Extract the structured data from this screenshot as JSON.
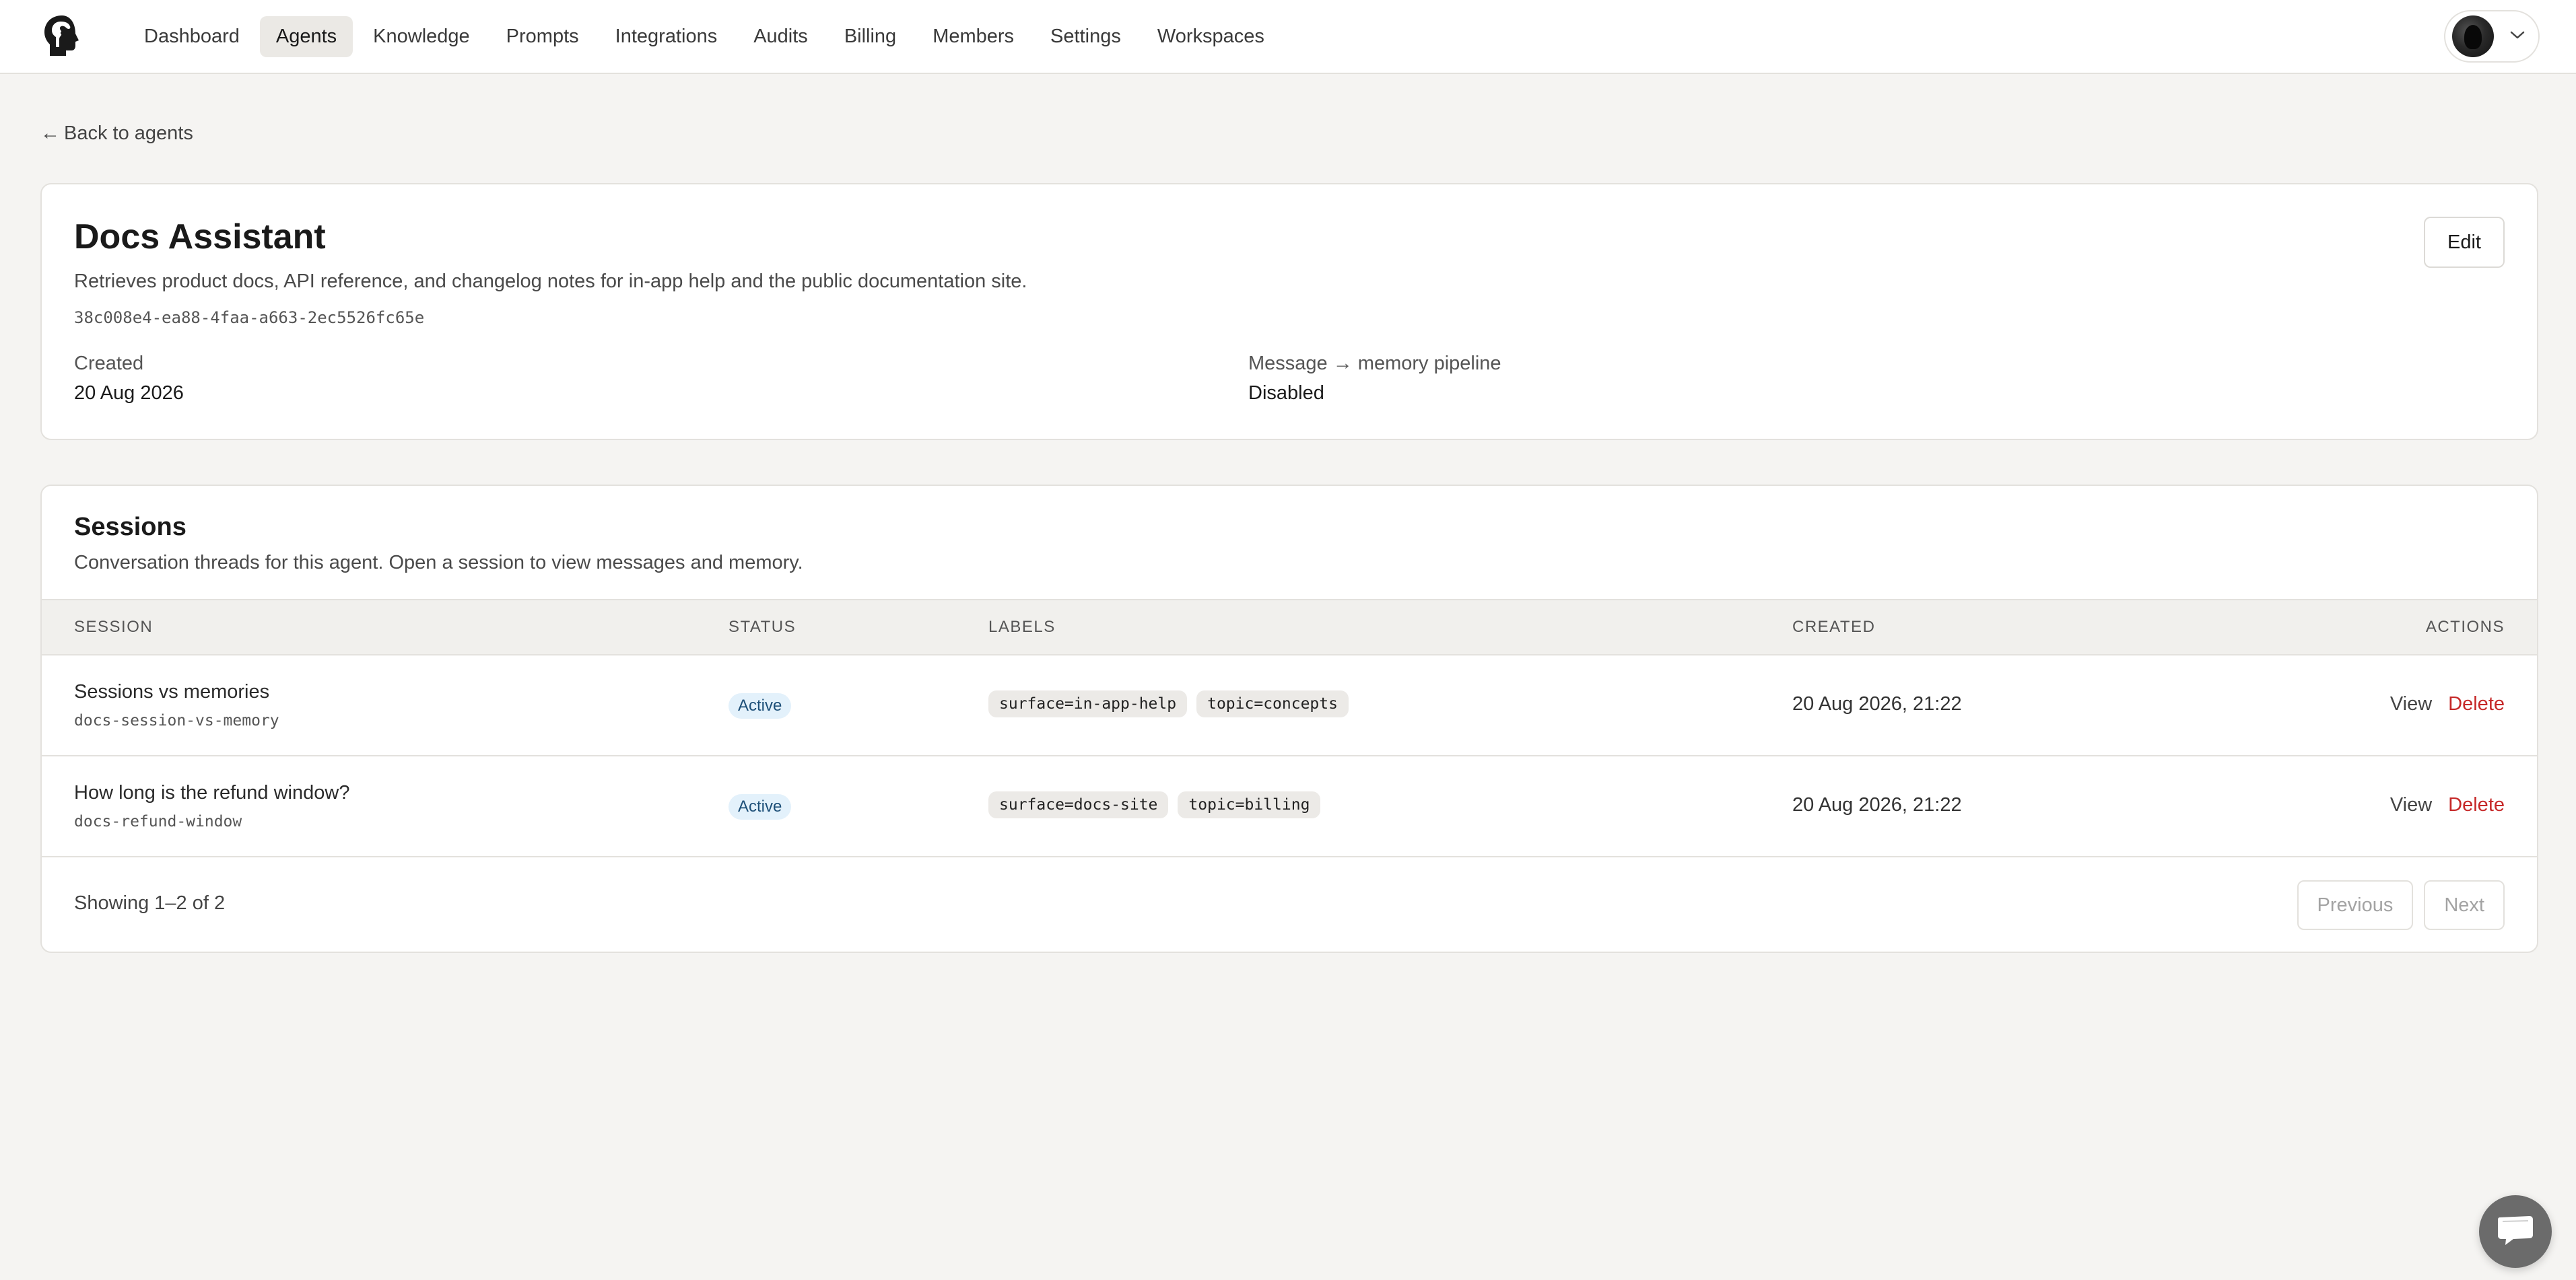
{
  "nav": {
    "items": [
      {
        "label": "Dashboard",
        "active": false
      },
      {
        "label": "Agents",
        "active": true
      },
      {
        "label": "Knowledge",
        "active": false
      },
      {
        "label": "Prompts",
        "active": false
      },
      {
        "label": "Integrations",
        "active": false
      },
      {
        "label": "Audits",
        "active": false
      },
      {
        "label": "Billing",
        "active": false
      },
      {
        "label": "Members",
        "active": false
      },
      {
        "label": "Settings",
        "active": false
      },
      {
        "label": "Workspaces",
        "active": false
      }
    ]
  },
  "back_link": {
    "arrow": "←",
    "label": "Back to agents"
  },
  "agent": {
    "name": "Docs Assistant",
    "description": "Retrieves product docs, API reference, and changelog notes for in-app help and the public documentation site.",
    "id": "38c008e4-ea88-4faa-a663-2ec5526fc65e",
    "edit_label": "Edit",
    "created_label": "Created",
    "created_value": "20 Aug 2026",
    "pipeline_label": "Message → memory pipeline",
    "pipeline_value": "Disabled"
  },
  "sessions": {
    "title": "Sessions",
    "description": "Conversation threads for this agent. Open a session to view messages and memory.",
    "columns": [
      "Session",
      "Status",
      "Labels",
      "Created",
      "Actions"
    ],
    "rows": [
      {
        "title": "Sessions vs memories",
        "slug": "docs-session-vs-memory",
        "status": "Active",
        "labels": [
          "surface=in-app-help",
          "topic=concepts"
        ],
        "created": "20 Aug 2026, 21:22",
        "view_label": "View",
        "delete_label": "Delete"
      },
      {
        "title": "How long is the refund window?",
        "slug": "docs-refund-window",
        "status": "Active",
        "labels": [
          "surface=docs-site",
          "topic=billing"
        ],
        "created": "20 Aug 2026, 21:22",
        "view_label": "View",
        "delete_label": "Delete"
      }
    ],
    "summary": "Showing 1–2 of 2",
    "previous_label": "Previous",
    "next_label": "Next"
  },
  "icons": {
    "logo": "head-logo-icon",
    "account": "chevron-down-icon",
    "chat": "chat-bubble-icon"
  },
  "colors": {
    "background": "#f5f4f2",
    "delete": "#c62828",
    "active_badge_bg": "#e3f1fb",
    "active_badge_text": "#1d4f78"
  }
}
